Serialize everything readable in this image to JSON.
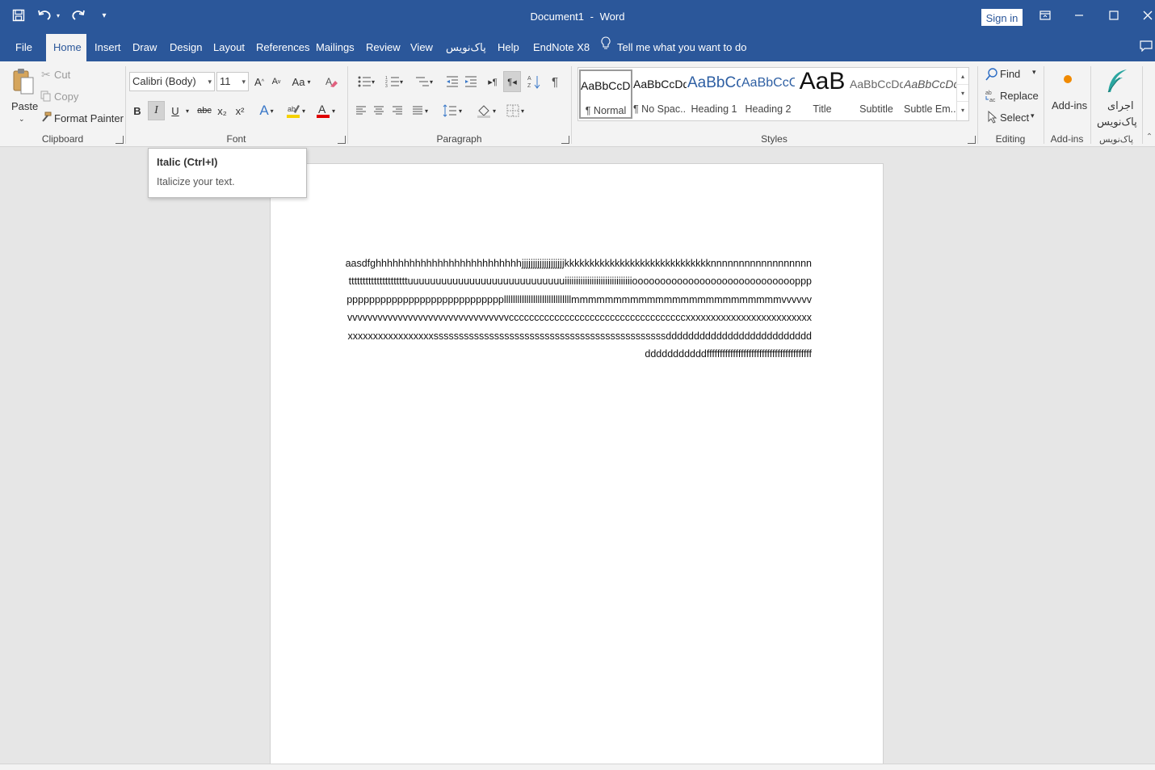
{
  "window": {
    "doc_name": "Document1",
    "separator": "-",
    "app_name": "Word",
    "sign_in": "Sign in"
  },
  "tabs": [
    "File",
    "Home",
    "Insert",
    "Draw",
    "Design",
    "Layout",
    "References",
    "Mailings",
    "Review",
    "View",
    "پاک‌نویس",
    "Help",
    "EndNote X8"
  ],
  "tell_me": "Tell me what you want to do",
  "clipboard": {
    "paste": "Paste",
    "cut": "Cut",
    "copy": "Copy",
    "format_painter": "Format Painter",
    "label": "Clipboard"
  },
  "font": {
    "family": "Calibri (Body)",
    "size": "11",
    "change_case": "Aa",
    "bold": "B",
    "italic": "I",
    "underline": "U",
    "strike": "abc",
    "subscript": "x₂",
    "superscript": "x²",
    "label": "Font"
  },
  "paragraph": {
    "label": "Paragraph"
  },
  "styles": {
    "items": [
      {
        "preview": "AaBbCcDd",
        "name": "¶ Normal"
      },
      {
        "preview": "AaBbCcDd",
        "name": "¶ No Spac..."
      },
      {
        "preview": "AaBbCc",
        "name": "Heading 1"
      },
      {
        "preview": "AaBbCcC",
        "name": "Heading 2"
      },
      {
        "preview": "AaB",
        "name": "Title"
      },
      {
        "preview": "AaBbCcDd",
        "name": "Subtitle"
      },
      {
        "preview": "AaBbCcDd",
        "name": "Subtle Em..."
      }
    ],
    "label": "Styles"
  },
  "editing": {
    "find": "Find",
    "replace": "Replace",
    "select": "Select",
    "label": "Editing"
  },
  "addins": {
    "button": "Add-ins",
    "label": "Add-ins"
  },
  "paknevis": {
    "line1": "اجرای",
    "line2": "پاک‌نویس",
    "label": "پاک‌نویس"
  },
  "tooltip": {
    "title": "Italic (Ctrl+I)",
    "description": "Italicize your text."
  },
  "document": {
    "text": "aasdfghhhhhhhhhhhhhhhhhhhhhhhhhhjjjjjjjjjjjjjjjjjjjkkkkkkkkkkkkkkkkkkkkkkkkkkkkknnnnnnnnnnnnnnnnnntttttttttttttttttttttuuuuuuuuuuuuuuuuuuuuuuuuuuuuiiiiiiiiiiiiiiiiiiiiiiiiiiiiiiooooooooooooooooooooooooooooopppppppppppppppppppppppppppppppllllllllllllllllllllllllllllllmmmmmmmmmmmmmmmmmmmmmmmmmvvvvvvvvvvvvvvvvvvvvvvvvvvvvvvvvvvvvvvcccccccccccccccccccccccccccccccccccxxxxxxxxxxxxxxxxxxxxxxxxxxxxxxxxxxxxxxxxxxssssssssssssssssssssssssssssssssssssssssssssssdddddddddddddddddddddddddddddddddddddffffffffffffffffffffffffffffffffffffffff"
  },
  "colors": {
    "brand": "#2b579a",
    "highlight": "#f5d100",
    "font_color": "#e00000",
    "addins_dot": "#f08a00",
    "feather": "#2aa6a0"
  }
}
